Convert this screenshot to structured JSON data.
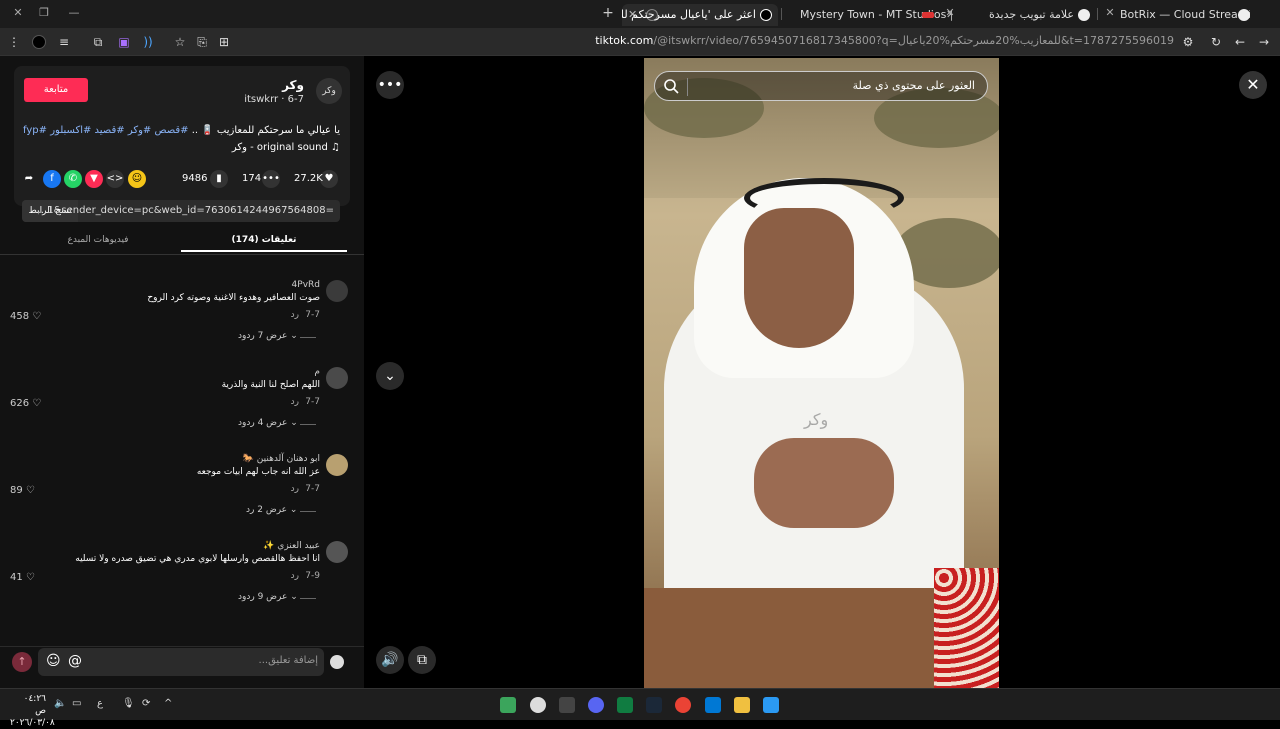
{
  "browser": {
    "tabs": [
      {
        "label": "BotRix — Cloud Streaming Bot",
        "active": false
      },
      {
        "label": "علامة تبويب جديدة",
        "active": false
      },
      {
        "label": "Mystery Town - MT Studios | M",
        "active": false
      },
      {
        "label": "اعثر على 'ياعيال مسرحتكم للـ",
        "active": true
      }
    ],
    "url_domain": "tiktok.com",
    "url_path": "/@itswkrr/video/7659450716817345800?q=للمعازيب%20مسرحتكم%20ياعيال&t=1787275596019",
    "new_tab_symbol": "+"
  },
  "search": {
    "placeholder": "العثور على محتوى ذي صلة"
  },
  "creator": {
    "name": "وكر",
    "handle_line": "itswkrr · 6-7",
    "avatar_text": "وكر",
    "follow_label": "متابعة",
    "caption_text": "يا عيالي ما سرحتكم للمعازيب 🪫 ..",
    "caption_tags": "#قصص #وكر #قصيد #اكسبلور #fyp",
    "sound": "original sound - وكر"
  },
  "stats": {
    "likes": "27.2K",
    "comments": "174",
    "saves": "9486"
  },
  "share_link": {
    "text": "...1&sender_device=pc&web_id=7630614244967564808=",
    "copy_label": "نسخ الرابط"
  },
  "panel_tabs": [
    {
      "label": "تعليقات (174)",
      "active": true
    },
    {
      "label": "فيديوهات المبدع",
      "active": false
    }
  ],
  "comments": [
    {
      "user": "4PvRd",
      "text": "صوت العصافير وهدوء الاغنية وصوته كرد الروح",
      "date": "7-7",
      "reply": "رد",
      "likes": "458",
      "more": "عرض 7 ردود"
    },
    {
      "user": "م",
      "text": "اللهم اصلح لنا النية والذرية",
      "date": "7-7",
      "reply": "رد",
      "likes": "626",
      "more": "عرض 4 ردود"
    },
    {
      "user": "ابو دهنان آلدهنين 🐎",
      "text": "عز الله انه جاب لهم ابيات موجعه",
      "date": "7-7",
      "reply": "رد",
      "likes": "89",
      "more": "عرض 2 رد"
    },
    {
      "user": "عبيد العنزي ✨",
      "text": "انا احفظ هالقصص وارسلها لابوي مدري هي تضيق صدره ولا تسليه",
      "date": "7-9",
      "reply": "رد",
      "likes": "41",
      "more": "عرض 9 ردود"
    }
  ],
  "comment_input": {
    "placeholder": "إضافة تعليق..."
  },
  "video": {
    "watermark": "وكر"
  },
  "taskbar": {
    "time": "٠٤:٢٦ ص",
    "date": "٢٠٢٦/٠٣/٠٨",
    "lang": "ع"
  },
  "colors": {
    "accent": "#fe2c55",
    "bg": "#121212",
    "link": "#8ab4f8"
  }
}
